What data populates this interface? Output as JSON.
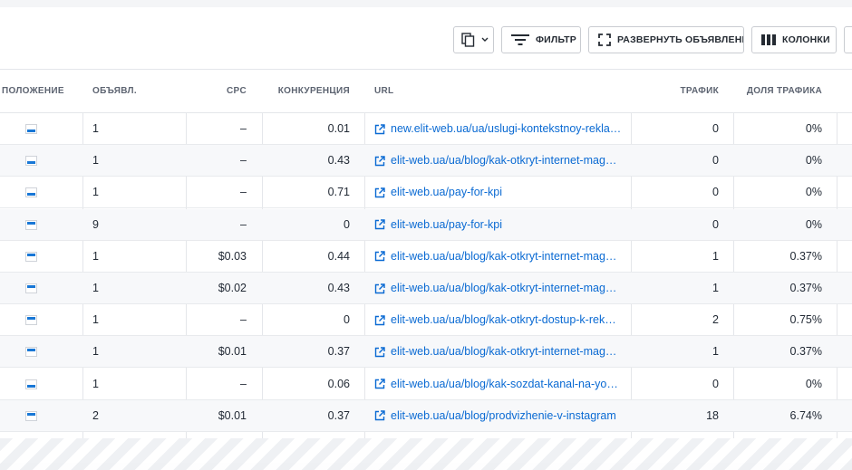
{
  "toolbar": {
    "copy_label": "",
    "filter_label": "ФИЛЬТР",
    "expand_label": "РАЗВЕРНУТЬ ОБЪЯВЛЕНИЯ",
    "columns_label": "КОЛОНКИ"
  },
  "columns": {
    "position": "ПОЛОЖЕНИЕ",
    "ads": "ОБЪЯВЛ.",
    "cpc": "CPC",
    "competition": "КОНКУРЕНЦИЯ",
    "url": "URL",
    "traffic": "ТРАФИК",
    "traffic_share": "ДОЛЯ ТРАФИКА"
  },
  "rows": [
    {
      "pos_type": "bottom",
      "ads": "1",
      "cpc": "–",
      "competition": "0.01",
      "url": "new.elit-web.ua/ua/uslugi-kontekstnoy-rekla…",
      "traffic": "0",
      "share": "0%"
    },
    {
      "pos_type": "bottom",
      "ads": "1",
      "cpc": "–",
      "competition": "0.43",
      "url": "elit-web.ua/ua/blog/kak-otkryt-internet-mag…",
      "traffic": "0",
      "share": "0%"
    },
    {
      "pos_type": "bottom",
      "ads": "1",
      "cpc": "–",
      "competition": "0.71",
      "url": "elit-web.ua/pay-for-kpi",
      "traffic": "0",
      "share": "0%"
    },
    {
      "pos_type": "top",
      "ads": "9",
      "cpc": "–",
      "competition": "0",
      "url": "elit-web.ua/pay-for-kpi",
      "traffic": "0",
      "share": "0%"
    },
    {
      "pos_type": "top",
      "ads": "1",
      "cpc": "$0.03",
      "competition": "0.44",
      "url": "elit-web.ua/ua/blog/kak-otkryt-internet-mag…",
      "traffic": "1",
      "share": "0.37%"
    },
    {
      "pos_type": "top",
      "ads": "1",
      "cpc": "$0.02",
      "competition": "0.43",
      "url": "elit-web.ua/ua/blog/kak-otkryt-internet-mag…",
      "traffic": "1",
      "share": "0.37%"
    },
    {
      "pos_type": "top",
      "ads": "1",
      "cpc": "–",
      "competition": "0",
      "url": "elit-web.ua/ua/blog/kak-otkryt-dostup-k-rek…",
      "traffic": "2",
      "share": "0.75%"
    },
    {
      "pos_type": "top",
      "ads": "1",
      "cpc": "$0.01",
      "competition": "0.37",
      "url": "elit-web.ua/ua/blog/kak-otkryt-internet-mag…",
      "traffic": "1",
      "share": "0.37%"
    },
    {
      "pos_type": "bottom",
      "ads": "1",
      "cpc": "–",
      "competition": "0.06",
      "url": "elit-web.ua/ua/blog/kak-sozdat-kanal-na-yo…",
      "traffic": "0",
      "share": "0%"
    },
    {
      "pos_type": "top",
      "ads": "2",
      "cpc": "$0.01",
      "competition": "0.37",
      "url": "elit-web.ua/ua/blog/prodvizhenie-v-instagram",
      "traffic": "18",
      "share": "6.74%"
    }
  ],
  "colors": {
    "link": "#0a6ad3",
    "position_marker": "#1877d6",
    "header_text": "#5d6471"
  }
}
